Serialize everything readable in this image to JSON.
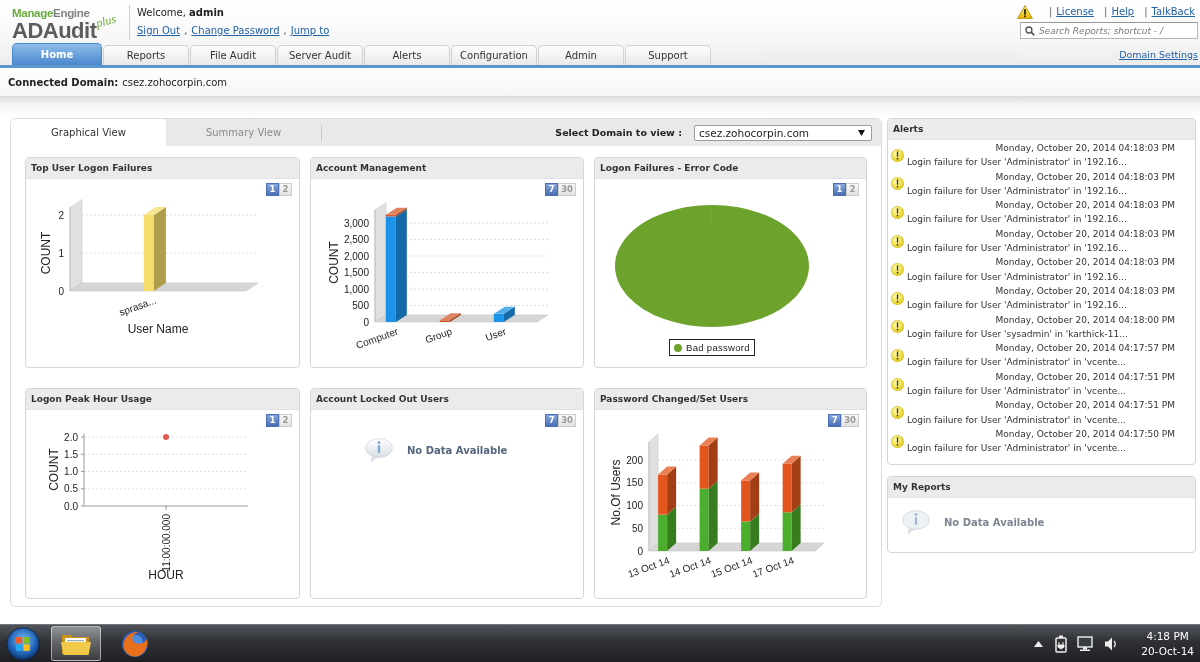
{
  "header": {
    "logo": {
      "brand_parts": [
        "Manage",
        "Engine"
      ],
      "product": "ADAudit",
      "edition": "plus"
    },
    "welcome": "Welcome, **admin**",
    "user_links": [
      "Sign Out",
      "Change Password",
      "Jump to"
    ],
    "link_separator": ",",
    "top_links": [
      "License",
      "Help",
      "TalkBack"
    ],
    "top_link_separator": "|",
    "search": {
      "placeholder": "Search Reports; shortcut - /"
    }
  },
  "tabs": [
    {
      "label": "Home",
      "selected": true
    },
    {
      "label": "Reports",
      "selected": false
    },
    {
      "label": "File Audit",
      "selected": false
    },
    {
      "label": "Server Audit",
      "selected": false
    },
    {
      "label": "Alerts",
      "selected": false
    },
    {
      "label": "Configuration",
      "selected": false
    },
    {
      "label": "Admin",
      "selected": false
    },
    {
      "label": "Support",
      "selected": false
    }
  ],
  "domain_settings_link": "Domain Settings",
  "connected_domain": {
    "label": "Connected Domain:",
    "value": "csez.zohocorpin.com"
  },
  "dashboard": {
    "view_tabs": [
      {
        "label": "Graphical View",
        "selected": true
      },
      {
        "label": "Summary View",
        "selected": false
      }
    ],
    "domain_select": {
      "label": "Select Domain to view :",
      "value": "csez.zohocorpin.com"
    },
    "widgets": [
      {
        "kind": "chart",
        "title": "Top User Logon Failures",
        "pager": [
          {
            "label": "1",
            "selected": true
          },
          {
            "label": "2",
            "selected": false
          }
        ],
        "chart_data": {
          "type": "bar",
          "xlabel": "User Name",
          "ylabel": "COUNT",
          "categories": [
            "sprasa..."
          ],
          "series": [
            {
              "color": "#f6dc6a",
              "values": [
                2
              ]
            }
          ],
          "ylim": [
            0,
            2.2
          ],
          "yticks": [
            0,
            1,
            2
          ],
          "grid": true
        }
      },
      {
        "kind": "chart",
        "title": "Account Management",
        "pager": [
          {
            "label": "7",
            "selected": true
          },
          {
            "label": "30",
            "selected": false
          }
        ],
        "chart_data": {
          "type": "bar",
          "ylabel": "COUNT",
          "categories": [
            "Computer",
            "Group",
            "User"
          ],
          "stacked": true,
          "series": [
            {
              "color": "#1a93e8",
              "values": [
                3200,
                0,
                250
              ]
            },
            {
              "color": "#d4572a",
              "values": [
                50,
                50,
                0
              ]
            }
          ],
          "ylim": [
            0,
            3400
          ],
          "yticks": [
            {
              "value": 0,
              "label": "0"
            },
            {
              "value": 500,
              "label": "500"
            },
            {
              "value": 1000,
              "label": "1,000"
            },
            {
              "value": 1500,
              "label": "1,500"
            },
            {
              "value": 2000,
              "label": "2,000"
            },
            {
              "value": 2500,
              "label": "2,500"
            },
            {
              "value": 3000,
              "label": "3,000"
            }
          ],
          "grid": true
        }
      },
      {
        "kind": "chart",
        "title": "Logon Failures - Error Code",
        "pager": [
          {
            "label": "1",
            "selected": true
          },
          {
            "label": "2",
            "selected": false
          }
        ],
        "chart_data": {
          "type": "pie",
          "series": [
            {
              "name": "Bad password",
              "color": "#6da22c",
              "values": [
                1
              ]
            }
          ]
        }
      },
      {
        "kind": "chart",
        "title": "Logon Peak Hour Usage",
        "pager": [
          {
            "label": "1",
            "selected": true
          },
          {
            "label": "2",
            "selected": false
          }
        ],
        "chart_data": {
          "type": "line",
          "xlabel": "HOUR",
          "ylabel": "COUNT",
          "categories": [
            "11:00:00.000"
          ],
          "series": [
            {
              "color": "#e05a4e",
              "marker": "circle",
              "values": [
                2
              ]
            }
          ],
          "ylim": [
            0,
            2.1
          ],
          "yticks": [
            {
              "value": 0,
              "label": "0.0"
            },
            {
              "value": 0.5,
              "label": "0.5"
            },
            {
              "value": 1,
              "label": "1.0"
            },
            {
              "value": 1.5,
              "label": "1.5"
            },
            {
              "value": 2,
              "label": "2.0"
            }
          ],
          "grid": true
        }
      },
      {
        "kind": "empty",
        "title": "Account Locked Out Users",
        "pager": [
          {
            "label": "7",
            "selected": true
          },
          {
            "label": "30",
            "selected": false
          }
        ],
        "message": "No Data Available"
      },
      {
        "kind": "chart",
        "title": "Password Changed/Set Users",
        "pager": [
          {
            "label": "7",
            "selected": true
          },
          {
            "label": "30",
            "selected": false
          }
        ],
        "chart_data": {
          "type": "bar",
          "ylabel": "No.Of Users",
          "categories": [
            "13 Oct 14",
            "14 Oct 14",
            "15 Oct 14",
            "17 Oct 14"
          ],
          "stacked": true,
          "series": [
            {
              "color": "#4cae2c",
              "values": [
                80,
                137,
                65,
                85
              ]
            },
            {
              "color": "#e2561d",
              "values": [
                88,
                95,
                90,
                107
              ]
            }
          ],
          "ylim": [
            0,
            240
          ],
          "yticks": [
            0,
            50,
            100,
            150,
            200
          ],
          "grid": true
        }
      }
    ]
  },
  "alerts": {
    "title": "Alerts",
    "items": [
      {
        "time": "Monday, October 20, 2014 04:18:03 PM",
        "message": "Login failure for User 'Administrator' in '192.16..."
      },
      {
        "time": "Monday, October 20, 2014 04:18:03 PM",
        "message": "Login failure for User 'Administrator' in '192.16..."
      },
      {
        "time": "Monday, October 20, 2014 04:18:03 PM",
        "message": "Login failure for User 'Administrator' in '192.16..."
      },
      {
        "time": "Monday, October 20, 2014 04:18:03 PM",
        "message": "Login failure for User 'Administrator' in '192.16..."
      },
      {
        "time": "Monday, October 20, 2014 04:18:03 PM",
        "message": "Login failure for User 'Administrator' in '192.16..."
      },
      {
        "time": "Monday, October 20, 2014 04:18:03 PM",
        "message": "Login failure for User 'Administrator' in '192.16..."
      },
      {
        "time": "Monday, October 20, 2014 04:18:00 PM",
        "message": "Login failure for User 'sysadmin' in 'karthick-11..."
      },
      {
        "time": "Monday, October 20, 2014 04:17:57 PM",
        "message": "Login failure for User 'Administrator' in 'vcente..."
      },
      {
        "time": "Monday, October 20, 2014 04:17:51 PM",
        "message": "Login failure for User 'Administrator' in 'vcente..."
      },
      {
        "time": "Monday, October 20, 2014 04:17:51 PM",
        "message": "Login failure for User 'Administrator' in 'vcente..."
      },
      {
        "time": "Monday, October 20, 2014 04:17:50 PM",
        "message": "Login failure for User 'Administrator' in 'vcente..."
      }
    ]
  },
  "my_reports": {
    "title": "My Reports",
    "message": "No Data Available"
  },
  "taskbar": {
    "apps": [
      {
        "kind": "folder",
        "selected": true
      },
      {
        "kind": "browser",
        "selected": false
      }
    ],
    "clock": {
      "time": "4:18 PM",
      "date": "20-Oct-14"
    }
  }
}
